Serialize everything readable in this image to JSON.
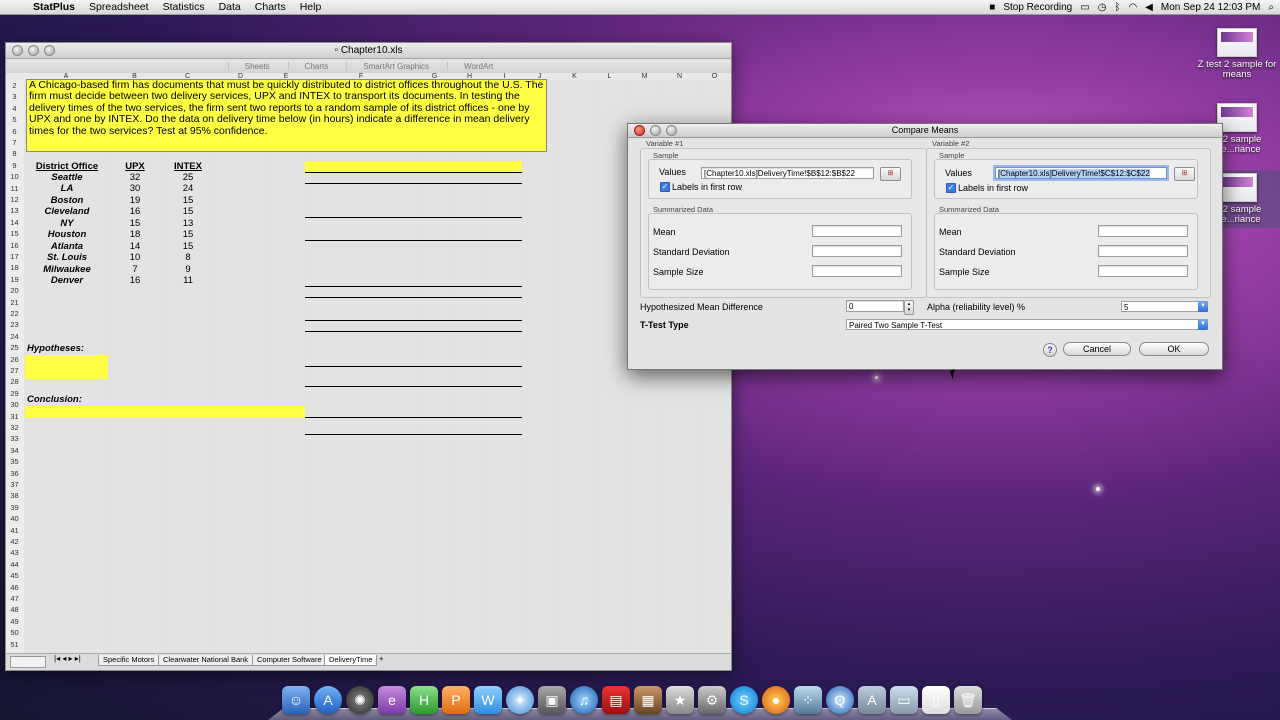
{
  "menubar": {
    "app": "StatPlus",
    "items": [
      "Spreadsheet",
      "Statistics",
      "Data",
      "Charts",
      "Help"
    ],
    "recording": "Stop Recording",
    "clock": "Mon Sep 24  12:03 PM"
  },
  "desktop_icons": [
    {
      "label": "Z test 2 sample for means"
    },
    {
      "label": "st 2 sample me...riance"
    },
    {
      "label": "st 2 sample me...riance"
    }
  ],
  "excel": {
    "title": "Chapter10.xls",
    "ribbon": [
      "Sheets",
      "Charts",
      "SmartArt Graphics",
      "WordArt"
    ],
    "columns": [
      "A",
      "B",
      "C",
      "D",
      "E",
      "F",
      "G",
      "H",
      "I",
      "J",
      "K",
      "L",
      "M",
      "N",
      "O"
    ],
    "problem_text": "A Chicago-based firm has documents that must be quickly distributed to district offices throughout the U.S. The firm must decide between two delivery services, UPX and INTEX to transport its documents.  In testing the delivery times of the two services, the firm sent two reports to a random sample of its district offices - one by UPX and one by INTEX. Do the data on delivery time below (in hours) indicate a difference in mean delivery times for the two services?  Test at 95% confidence.",
    "table_headers": [
      "District Office",
      "UPX",
      "INTEX"
    ],
    "rows": [
      [
        "Seattle",
        "32",
        "25"
      ],
      [
        "LA",
        "30",
        "24"
      ],
      [
        "Boston",
        "19",
        "15"
      ],
      [
        "Cleveland",
        "16",
        "15"
      ],
      [
        "NY",
        "15",
        "13"
      ],
      [
        "Houston",
        "18",
        "15"
      ],
      [
        "Atlanta",
        "14",
        "15"
      ],
      [
        "St. Louis",
        "10",
        "8"
      ],
      [
        "Milwaukee",
        "7",
        "9"
      ],
      [
        "Denver",
        "16",
        "11"
      ]
    ],
    "hypotheses_label": "Hypotheses:",
    "conclusion_label": "Conclusion:",
    "sheet_tabs": [
      "Specific Motors",
      "Clearwater National Bank",
      "Computer Software",
      "DeliveryTime"
    ],
    "active_tab": "DeliveryTime"
  },
  "dialog": {
    "title": "Compare Means",
    "var1": {
      "group": "Variable #1",
      "sample": "Sample",
      "values_label": "Values",
      "values": "[Chapter10.xls]DeliveryTime!$B$12:$B$22",
      "labels_first_row": "Labels in first row",
      "summarized": "Summarized Data",
      "mean": "Mean",
      "sd": "Standard Deviation",
      "size": "Sample Size"
    },
    "var2": {
      "group": "Variable #2",
      "sample": "Sample",
      "values_label": "Values",
      "values": "[Chapter10.xls]DeliveryTime!$C$12:$C$22",
      "labels_first_row": "Labels in first row",
      "summarized": "Summarized Data",
      "mean": "Mean",
      "sd": "Standard Deviation",
      "size": "Sample Size"
    },
    "hyp_diff_label": "Hypothesized Mean Difference",
    "hyp_diff_value": "0",
    "alpha_label": "Alpha (reliability level) %",
    "alpha_value": "5",
    "ttest_label": "T-Test Type",
    "ttest_value": "Paired Two Sample T-Test",
    "help": "?",
    "cancel": "Cancel",
    "ok": "OK"
  }
}
